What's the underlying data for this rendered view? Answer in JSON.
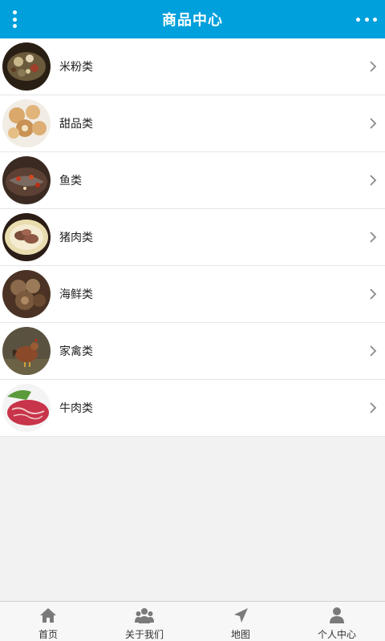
{
  "header": {
    "title": "商品中心",
    "menu_icon": "vertical-dots-menu-icon",
    "more_icon": "horizontal-dots-more-icon"
  },
  "categories": [
    {
      "label": "米粉类",
      "image": "rice-noodle-dish"
    },
    {
      "label": "甜品类",
      "image": "dessert-pastries"
    },
    {
      "label": "鱼类",
      "image": "fish-dish"
    },
    {
      "label": "猪肉类",
      "image": "pork-dish"
    },
    {
      "label": "海鲜类",
      "image": "seafood-dish"
    },
    {
      "label": "家禽类",
      "image": "poultry-chicken"
    },
    {
      "label": "牛肉类",
      "image": "beef-slices"
    }
  ],
  "tabbar": {
    "tabs": [
      {
        "label": "首页",
        "icon": "home-icon"
      },
      {
        "label": "关于我们",
        "icon": "group-icon"
      },
      {
        "label": "地图",
        "icon": "location-arrow-icon"
      },
      {
        "label": "个人中心",
        "icon": "user-icon"
      }
    ]
  },
  "colors": {
    "header_bg": "#00a0dc",
    "background": "#f2f2f2",
    "tab_icon": "#7a7a7a"
  }
}
